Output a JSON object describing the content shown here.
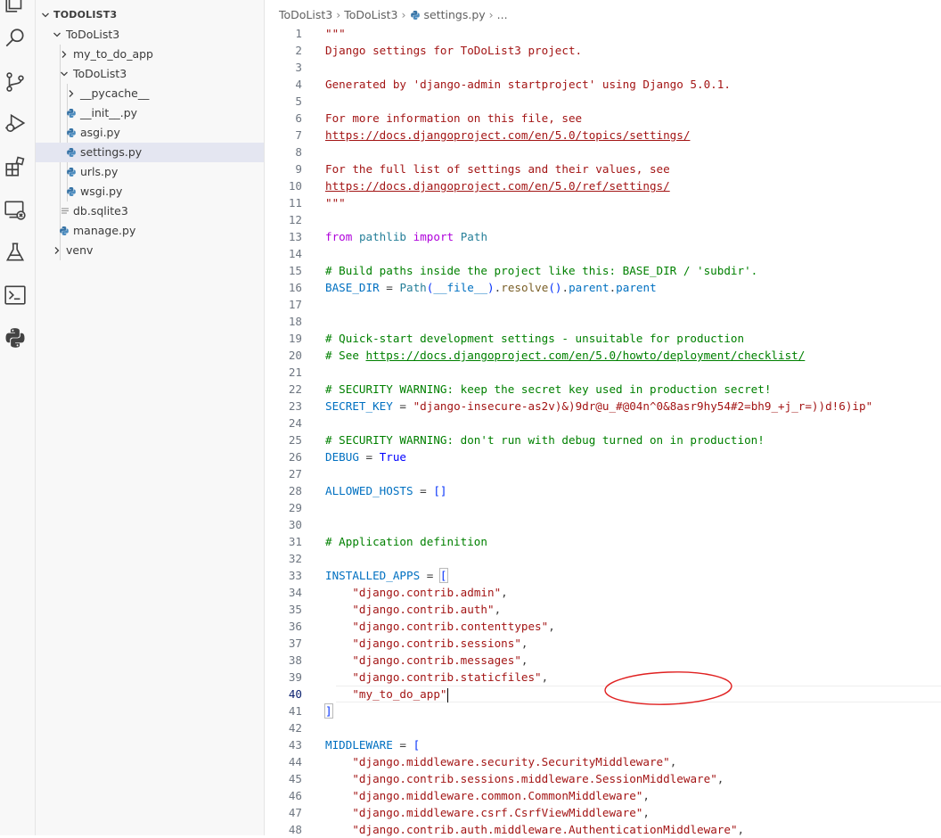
{
  "breadcrumb": {
    "root": "ToDoList3",
    "folder": "ToDoList3",
    "file": "settings.py",
    "more": "..."
  },
  "explorer": {
    "section": "TODOLIST3",
    "items": [
      {
        "label": "ToDoList3"
      },
      {
        "label": "my_to_do_app"
      },
      {
        "label": "ToDoList3"
      },
      {
        "label": "__pycache__"
      },
      {
        "label": "__init__.py"
      },
      {
        "label": "asgi.py"
      },
      {
        "label": "settings.py"
      },
      {
        "label": "urls.py"
      },
      {
        "label": "wsgi.py"
      },
      {
        "label": "db.sqlite3"
      },
      {
        "label": "manage.py"
      },
      {
        "label": "venv"
      }
    ]
  },
  "activity_icons": [
    "files-icon",
    "search-icon",
    "source-control-icon",
    "run-debug-icon",
    "extensions-icon",
    "remote-explorer-icon",
    "testing-icon",
    "terminal-icon",
    "python-icon"
  ],
  "editor": {
    "lines": [
      {
        "n": "1",
        "t": "\"\"\""
      },
      {
        "n": "2",
        "t": "Django settings for ToDoList3 project."
      },
      {
        "n": "3",
        "t": ""
      },
      {
        "n": "4",
        "t": "Generated by 'django-admin startproject' using Django 5.0.1."
      },
      {
        "n": "5",
        "t": ""
      },
      {
        "n": "6",
        "t": "For more information on this file, see"
      },
      {
        "n": "7",
        "t": "https://docs.djangoproject.com/en/5.0/topics/settings/"
      },
      {
        "n": "8",
        "t": ""
      },
      {
        "n": "9",
        "t": "For the full list of settings and their values, see"
      },
      {
        "n": "10",
        "t": "https://docs.djangoproject.com/en/5.0/ref/settings/"
      },
      {
        "n": "11",
        "t": "\"\"\""
      },
      {
        "n": "12",
        "t": ""
      },
      {
        "n": "13",
        "t": "from pathlib import Path"
      },
      {
        "n": "14",
        "t": ""
      },
      {
        "n": "15",
        "t": "# Build paths inside the project like this: BASE_DIR / 'subdir'."
      },
      {
        "n": "16",
        "t": "BASE_DIR = Path(__file__).resolve().parent.parent"
      },
      {
        "n": "17",
        "t": ""
      },
      {
        "n": "18",
        "t": ""
      },
      {
        "n": "19",
        "t": "# Quick-start development settings - unsuitable for production"
      },
      {
        "n": "20",
        "t": "# See https://docs.djangoproject.com/en/5.0/howto/deployment/checklist/"
      },
      {
        "n": "21",
        "t": ""
      },
      {
        "n": "22",
        "t": "# SECURITY WARNING: keep the secret key used in production secret!"
      },
      {
        "n": "23",
        "t": "SECRET_KEY = \"django-insecure-as2v)&)9dr@u_#@04n^0&8asr9hy54#2=bh9_+j_r=))d!6)ip\""
      },
      {
        "n": "24",
        "t": ""
      },
      {
        "n": "25",
        "t": "# SECURITY WARNING: don't run with debug turned on in production!"
      },
      {
        "n": "26",
        "t": "DEBUG = True"
      },
      {
        "n": "27",
        "t": ""
      },
      {
        "n": "28",
        "t": "ALLOWED_HOSTS = []"
      },
      {
        "n": "29",
        "t": ""
      },
      {
        "n": "30",
        "t": ""
      },
      {
        "n": "31",
        "t": "# Application definition"
      },
      {
        "n": "32",
        "t": ""
      },
      {
        "n": "33",
        "t": "INSTALLED_APPS = ["
      },
      {
        "n": "34",
        "t": "    \"django.contrib.admin\","
      },
      {
        "n": "35",
        "t": "    \"django.contrib.auth\","
      },
      {
        "n": "36",
        "t": "    \"django.contrib.contenttypes\","
      },
      {
        "n": "37",
        "t": "    \"django.contrib.sessions\","
      },
      {
        "n": "38",
        "t": "    \"django.contrib.messages\","
      },
      {
        "n": "39",
        "t": "    \"django.contrib.staticfiles\","
      },
      {
        "n": "40",
        "t": "    \"my_to_do_app\""
      },
      {
        "n": "41",
        "t": "]"
      },
      {
        "n": "42",
        "t": ""
      },
      {
        "n": "43",
        "t": "MIDDLEWARE = ["
      },
      {
        "n": "44",
        "t": "    \"django.middleware.security.SecurityMiddleware\","
      },
      {
        "n": "45",
        "t": "    \"django.contrib.sessions.middleware.SessionMiddleware\","
      },
      {
        "n": "46",
        "t": "    \"django.middleware.common.CommonMiddleware\","
      },
      {
        "n": "47",
        "t": "    \"django.middleware.csrf.CsrfViewMiddleware\","
      },
      {
        "n": "48",
        "t": "    \"django.contrib.auth.middleware.AuthenticationMiddleware\","
      }
    ],
    "current_line": "40"
  },
  "colors": {
    "string": "#a31515",
    "keyword": "#af00db",
    "variable": "#0070c1",
    "comment": "#008000",
    "selection": "#e4e6f1",
    "annotation": "#e02020"
  }
}
